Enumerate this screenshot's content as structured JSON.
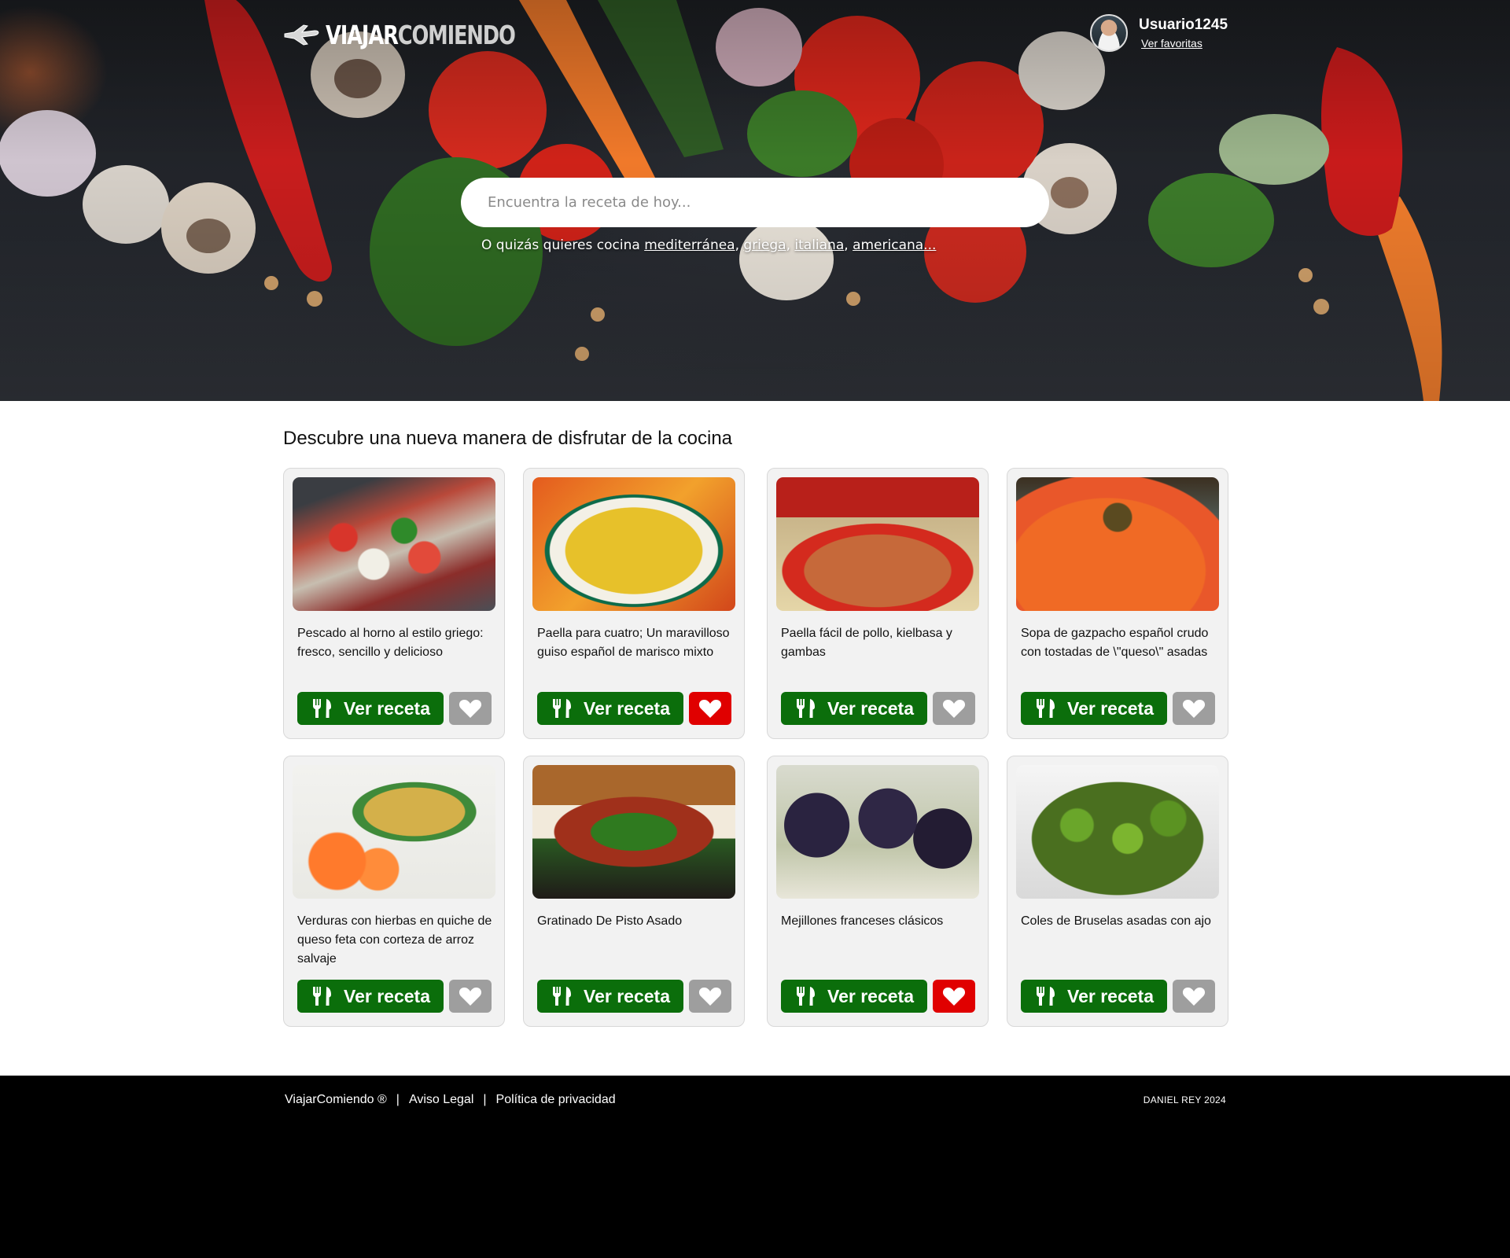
{
  "brand": {
    "part1": "VIAJAR",
    "part2": "COMIENDO"
  },
  "user": {
    "name": "Usuario1245",
    "favorites_link": "Ver favoritas"
  },
  "search": {
    "placeholder": "Encuentra la receta de hoy...",
    "suggest_prefix": "O quizás quieres cocina",
    "suggestions": [
      "mediterránea",
      "griega",
      "italiana",
      "americana..."
    ]
  },
  "section_title": "Descubre una nueva manera de disfrutar de la cocina",
  "view_label": "Ver receta",
  "recipes": [
    {
      "title": "Pescado al horno al estilo griego: fresco, sencillo y delicioso",
      "favorite": false,
      "image": "baked-greek-fish"
    },
    {
      "title": "Paella para cuatro; Un maravilloso guiso español de marisco mixto",
      "favorite": true,
      "image": "seafood-paella"
    },
    {
      "title": "Paella fácil de pollo, kielbasa y gambas",
      "favorite": false,
      "image": "chicken-paella"
    },
    {
      "title": "Sopa de gazpacho español crudo con tostadas de \\\"queso\\\" asadas",
      "favorite": false,
      "image": "gazpacho-soup"
    },
    {
      "title": "Verduras con hierbas en quiche de queso feta con corteza de arroz salvaje",
      "favorite": false,
      "image": "vegetable-quiche"
    },
    {
      "title": "Gratinado De Pisto Asado",
      "favorite": false,
      "image": "pisto-gratin"
    },
    {
      "title": "Mejillones franceses clásicos",
      "favorite": true,
      "image": "french-mussels"
    },
    {
      "title": "Coles de Bruselas asadas con ajo",
      "favorite": false,
      "image": "brussels-sprouts"
    }
  ],
  "footer": {
    "brand": "ViajarComiendo ®",
    "separator": "|",
    "legal": "Aviso Legal",
    "privacy": "Política de privacidad",
    "credit": "DANIEL REY 2024"
  },
  "colors": {
    "view_button": "#0b6e0b",
    "favorite_on": "#e00000",
    "favorite_off": "#9e9e9e",
    "footer_bg": "#000000"
  },
  "icons": {
    "view": "utensils-icon",
    "favorite": "heart-icon",
    "logo": "plane-icon"
  }
}
